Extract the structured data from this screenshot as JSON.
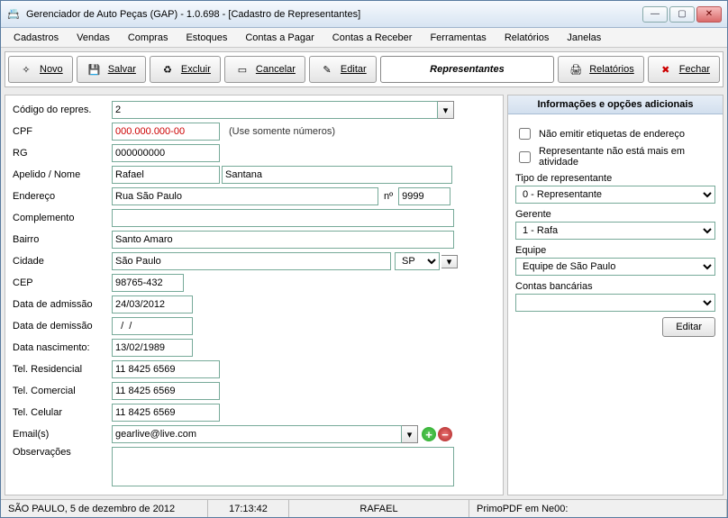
{
  "window": {
    "title": "Gerenciador de Auto Peças (GAP) - 1.0.698 - [Cadastro de Representantes]"
  },
  "menu": [
    "Cadastros",
    "Vendas",
    "Compras",
    "Estoques",
    "Contas a Pagar",
    "Contas a Receber",
    "Ferramentas",
    "Relatórios",
    "Janelas"
  ],
  "toolbar": {
    "novo": "Novo",
    "salvar": "Salvar",
    "excluir": "Excluir",
    "cancelar": "Cancelar",
    "editar": "Editar",
    "title": "Representantes",
    "relatorios": "Relatórios",
    "fechar": "Fechar"
  },
  "labels": {
    "codigo": "Código do repres.",
    "cpf": "CPF",
    "cpf_hint": "(Use somente números)",
    "rg": "RG",
    "apelido": "Apelido / Nome",
    "endereco": "Endereço",
    "num": "nº",
    "complemento": "Complemento",
    "bairro": "Bairro",
    "cidade": "Cidade",
    "cep": "CEP",
    "admissao": "Data de admissão",
    "demissao": "Data de demissão",
    "nasc": "Data nascimento:",
    "tel_res": "Tel. Residencial",
    "tel_com": "Tel. Comercial",
    "tel_cel": "Tel. Celular",
    "emails": "Email(s)",
    "obs": "Observações"
  },
  "values": {
    "codigo": "2",
    "cpf": "000.000.000-00",
    "rg": "000000000",
    "apelido": "Rafael",
    "nome": "Santana",
    "endereco": "Rua São Paulo",
    "numero": "9999",
    "complemento": "",
    "bairro": "Santo Amaro",
    "cidade": "São Paulo",
    "uf": "SP",
    "cep": "98765-432",
    "admissao": "24/03/2012",
    "demissao": "  /  /",
    "nasc": "13/02/1989",
    "tel_res": "11 8425 6569",
    "tel_com": "11 8425 6569",
    "tel_cel": "11 8425 6569",
    "email": "gearlive@live.com",
    "obs": ""
  },
  "side": {
    "head": "Informações e opções adicionais",
    "chk1": "Não emitir etiquetas de endereço",
    "chk2": "Representante não está mais em atividade",
    "tipo_lbl": "Tipo de representante",
    "tipo": "0 - Representante",
    "gerente_lbl": "Gerente",
    "gerente": "1 - Rafa",
    "equipe_lbl": "Equipe",
    "equipe": "Equipe de São Paulo",
    "contas_lbl": "Contas bancárias",
    "contas": "",
    "editar": "Editar"
  },
  "status": {
    "loc": "SÃO PAULO, 5 de dezembro de 2012",
    "time": "17:13:42",
    "user": "RAFAEL",
    "printer": "PrimoPDF em Ne00:"
  }
}
